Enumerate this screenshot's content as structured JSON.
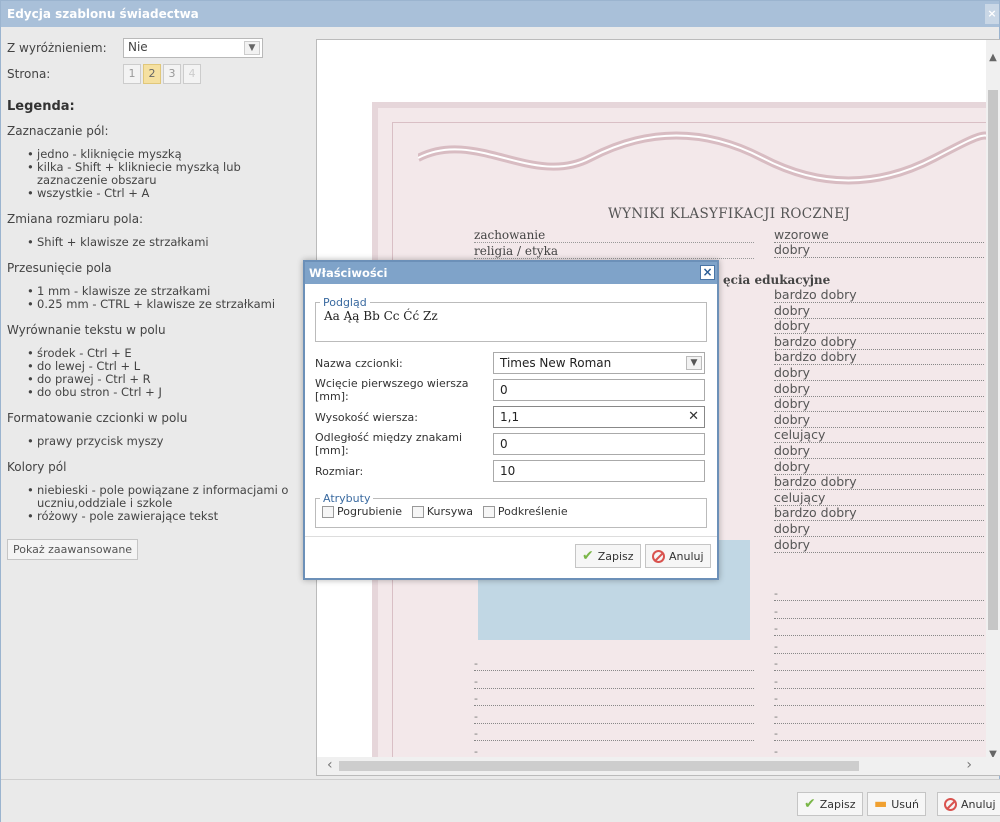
{
  "window": {
    "title": "Edycja szablonu świadectwa",
    "close": "×"
  },
  "left": {
    "wyroznienie_label": "Z wyróżnieniem:",
    "wyroznienie_value": "Nie",
    "strona_label": "Strona:",
    "pages": [
      "1",
      "2",
      "3",
      "4"
    ],
    "legend_title": "Legenda:",
    "sections": [
      {
        "title": "Zaznaczanie pól:",
        "items": [
          "jedno - kliknięcie myszką",
          "kilka - Shift + klikniecie myszką lub zaznaczenie obszaru",
          "wszystkie - Ctrl + A"
        ]
      },
      {
        "title": "Zmiana rozmiaru pola:",
        "items": [
          "Shift + klawisze ze strzałkami"
        ]
      },
      {
        "title": "Przesunięcie pola",
        "items": [
          "1 mm - klawisze ze strzałkami",
          "0.25 mm - CTRL + klawisze ze strzałkami"
        ]
      },
      {
        "title": "Wyrównanie tekstu w polu",
        "items": [
          "środek - Ctrl + E",
          "do lewej - Ctrl + L",
          "do prawej - Ctrl + R",
          "do obu stron - Ctrl + J"
        ]
      },
      {
        "title": "Formatowanie czcionki w polu",
        "items": [
          "prawy przycisk myszy"
        ]
      },
      {
        "title": "Kolory pól",
        "items": [
          "niebieski - pole powiązane z informacjami o uczniu,oddziale i szkole",
          "różowy - pole zawierające tekst"
        ]
      }
    ],
    "advanced_button": "Pokaż zaawansowane"
  },
  "certificate": {
    "title": "WYNIKI KLASYFIKACJI ROCZNEJ",
    "subjects": [
      "zachowanie",
      "religia / etyka"
    ],
    "heading": "ęcia edukacyjne",
    "grades": [
      "wzorowe",
      "dobry",
      "bardzo dobry",
      "dobry",
      "dobry",
      "bardzo dobry",
      "bardzo dobry",
      "dobry",
      "dobry",
      "dobry",
      "dobry",
      "celujący",
      "dobry",
      "dobry",
      "bardzo dobry",
      "celujący",
      "bardzo dobry",
      "dobry",
      "dobry"
    ],
    "dash": "-"
  },
  "dialog": {
    "title": "Właściwości",
    "preview_legend": "Podgląd",
    "preview_text": "Aa Ąą Bb Cc Ćć Zz",
    "font_label": "Nazwa czcionki:",
    "font_value": "Times New Roman",
    "indent_label": "Wcięcie pierwszego wiersza [mm]:",
    "indent_value": "0",
    "lineheight_label": "Wysokość wiersza:",
    "lineheight_value": "1,1",
    "spacing_label": "Odległość między znakami [mm]:",
    "spacing_value": "0",
    "size_label": "Rozmiar:",
    "size_value": "10",
    "attr_legend": "Atrybuty",
    "bold": "Pogrubienie",
    "italic": "Kursywa",
    "underline": "Podkreślenie",
    "save": "Zapisz",
    "cancel": "Anuluj"
  },
  "bottom": {
    "save": "Zapisz",
    "delete": "Usuń",
    "cancel": "Anuluj"
  }
}
